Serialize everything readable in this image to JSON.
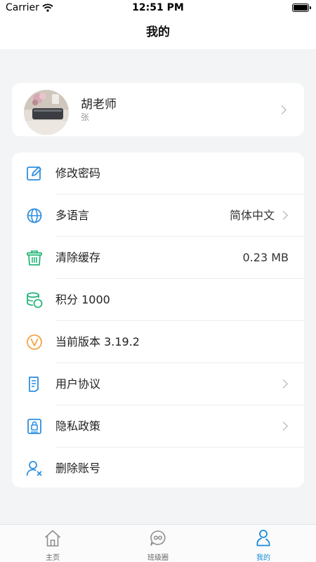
{
  "status_bar": {
    "carrier": "Carrier",
    "time": "12:51 PM"
  },
  "nav": {
    "title": "我的"
  },
  "profile": {
    "name": "胡老师",
    "subtitle": "张"
  },
  "menu": {
    "items": [
      {
        "icon": "edit-icon",
        "label": "修改密码",
        "value": "",
        "chevron": false
      },
      {
        "icon": "globe-icon",
        "label": "多语言",
        "value": "简体中文",
        "chevron": true
      },
      {
        "icon": "trash-icon",
        "label": "清除缓存",
        "value": "0.23 MB",
        "chevron": false
      },
      {
        "icon": "coins-icon",
        "label": "积分 1000",
        "value": "",
        "chevron": false
      },
      {
        "icon": "version-icon",
        "label": "当前版本 3.19.2",
        "value": "",
        "chevron": false
      },
      {
        "icon": "document-icon",
        "label": "用户协议",
        "value": "",
        "chevron": true
      },
      {
        "icon": "privacy-icon",
        "label": "隐私政策",
        "value": "",
        "chevron": true
      },
      {
        "icon": "delete-user-icon",
        "label": "删除账号",
        "value": "",
        "chevron": false
      }
    ]
  },
  "tabbar": {
    "tabs": [
      {
        "label": "主页",
        "icon": "home-icon",
        "active": false
      },
      {
        "label": "班级圈",
        "icon": "chat-icon",
        "active": false
      },
      {
        "label": "我的",
        "icon": "profile-icon",
        "active": true
      }
    ]
  },
  "colors": {
    "accent": "#1a8ad8",
    "icon_blue": "#2f8fe0",
    "icon_green": "#28b67a",
    "icon_orange": "#f2a54a",
    "background": "#f2f4f5"
  }
}
